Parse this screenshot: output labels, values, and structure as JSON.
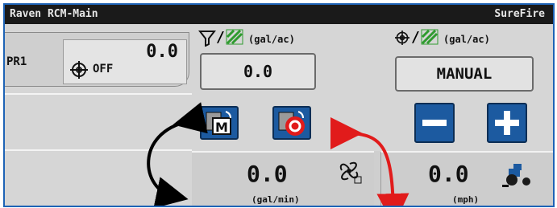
{
  "titlebar": {
    "left": "Raven RCM-Main",
    "right": "SureFire"
  },
  "product": {
    "label": "PR1",
    "value": "0.0",
    "status": "OFF"
  },
  "mid": {
    "header_units": "(gal/ac)",
    "rate_value": "0.0",
    "flow_value": "0.0",
    "flow_units": "(gal/min)",
    "mode_letter": "M"
  },
  "right": {
    "header_units": "(gal/ac)",
    "mode_label": "MANUAL",
    "speed_value": "0.0",
    "speed_units": "(mph)"
  },
  "icons": [
    "target-icon",
    "funnel-icon",
    "field-icon",
    "manual-mode-icon",
    "stop-mode-icon",
    "minus-icon",
    "plus-icon",
    "flowmeter-icon",
    "tractor-icon",
    "black-arrow-icon",
    "red-arrow-icon"
  ],
  "colors": {
    "accent": "#1c5aa0",
    "frame": "#1e63b6",
    "green": "#2f9b2f",
    "red": "#e11b1b"
  }
}
